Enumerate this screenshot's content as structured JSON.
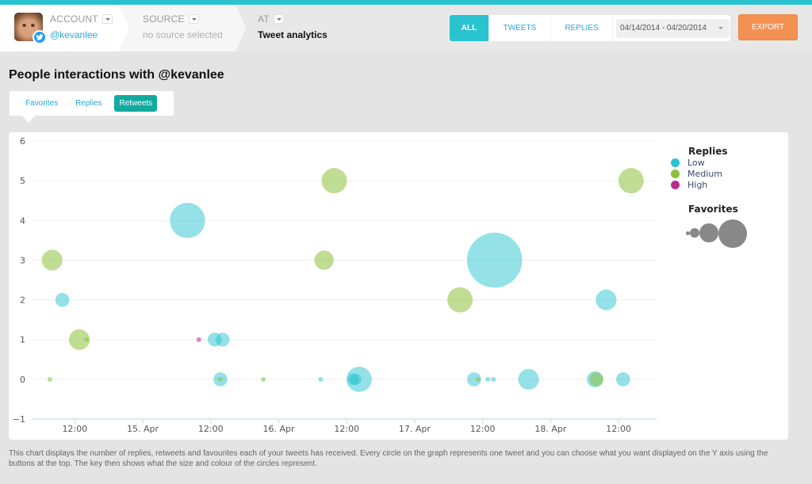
{
  "header": {
    "account": {
      "label": "ACCOUNT",
      "value": "@kevanlee"
    },
    "source": {
      "label": "SOURCE",
      "value": "no source selected"
    },
    "at": {
      "label": "AT",
      "value": "Tweet analytics"
    },
    "filters": [
      {
        "label": "ALL",
        "active": true
      },
      {
        "label": "TWEETS",
        "active": false
      },
      {
        "label": "REPLIES",
        "active": false
      }
    ],
    "date_range": "04/14/2014 - 04/20/2014",
    "export_label": "EXPORT"
  },
  "section_title": "People interactions with @kevanlee",
  "y_tabs": [
    {
      "label": "Favorites",
      "active": false
    },
    {
      "label": "Replies",
      "active": false
    },
    {
      "label": "Retweets",
      "active": true
    }
  ],
  "legend": {
    "color_title": "Replies",
    "color_items": [
      {
        "label": "Low",
        "color": "#2ac4d2"
      },
      {
        "label": "Medium",
        "color": "#8cc13c"
      },
      {
        "label": "High",
        "color": "#bb2c8e"
      }
    ],
    "size_title": "Favorites"
  },
  "footnote": "This chart displays the number of replies, retweets and favourites each of your tweets has received. Every circle on the graph represents one tweet and you can choose what you want displayed on the Y axis using the buttons at the top. The key then shows what the size and colour of the circles represent.",
  "chart_data": {
    "type": "scatter",
    "title": "People interactions with @kevanlee",
    "xlabel": "",
    "ylabel": "Retweets",
    "x_unit": "hours since 14 Apr 2014 00:00",
    "xlim_hours": [
      4.4,
      114.7
    ],
    "ylim": [
      -1,
      6
    ],
    "yticks": [
      -1,
      0,
      1,
      2,
      3,
      4,
      5,
      6
    ],
    "xticks": [
      {
        "hour": 12,
        "label": "12:00"
      },
      {
        "hour": 24,
        "label": "15. Apr"
      },
      {
        "hour": 36,
        "label": "12:00"
      },
      {
        "hour": 48,
        "label": "16. Apr"
      },
      {
        "hour": 60,
        "label": "12:00"
      },
      {
        "hour": 72,
        "label": "17. Apr"
      },
      {
        "hour": 84,
        "label": "12:00"
      },
      {
        "hour": 96,
        "label": "18. Apr"
      },
      {
        "hour": 108,
        "label": "12:00"
      }
    ],
    "grid": true,
    "size_encodes": "Favorites",
    "color_encodes": "Replies",
    "points": [
      {
        "hour": 7.6,
        "retweets": 0,
        "replies": "Medium",
        "favorites": 0
      },
      {
        "hour": 8.0,
        "retweets": 3,
        "replies": "Medium",
        "favorites": 6
      },
      {
        "hour": 9.8,
        "retweets": 2,
        "replies": "Low",
        "favorites": 2
      },
      {
        "hour": 12.8,
        "retweets": 1,
        "replies": "Medium",
        "favorites": 6
      },
      {
        "hour": 14.1,
        "retweets": 1,
        "replies": "Medium",
        "favorites": 0
      },
      {
        "hour": 31.9,
        "retweets": 4,
        "replies": "Low",
        "favorites": 22
      },
      {
        "hour": 33.9,
        "retweets": 1,
        "replies": "High",
        "favorites": 0
      },
      {
        "hour": 36.7,
        "retweets": 1,
        "replies": "Low",
        "favorites": 2
      },
      {
        "hour": 38.1,
        "retweets": 1,
        "replies": "Low",
        "favorites": 2
      },
      {
        "hour": 37.7,
        "retweets": 0,
        "replies": "Low",
        "favorites": 2
      },
      {
        "hour": 37.7,
        "retweets": 0,
        "replies": "Medium",
        "favorites": 0
      },
      {
        "hour": 45.3,
        "retweets": 0,
        "replies": "Medium",
        "favorites": 0
      },
      {
        "hour": 56.0,
        "retweets": 3,
        "replies": "Medium",
        "favorites": 5
      },
      {
        "hour": 57.8,
        "retweets": 5,
        "replies": "Medium",
        "favorites": 10
      },
      {
        "hour": 55.4,
        "retweets": 0,
        "replies": "Low",
        "favorites": 0
      },
      {
        "hour": 61.1,
        "retweets": 0,
        "replies": "Low",
        "favorites": 1
      },
      {
        "hour": 61.6,
        "retweets": 0,
        "replies": "Low",
        "favorites": 1
      },
      {
        "hour": 62.2,
        "retweets": 0,
        "replies": "Low",
        "favorites": 10
      },
      {
        "hour": 80.0,
        "retweets": 2,
        "replies": "Medium",
        "favorites": 10
      },
      {
        "hour": 86.1,
        "retweets": 3,
        "replies": "Low",
        "favorites": 60
      },
      {
        "hour": 82.5,
        "retweets": 0,
        "replies": "Low",
        "favorites": 2
      },
      {
        "hour": 83.2,
        "retweets": 0,
        "replies": "Medium",
        "favorites": 0
      },
      {
        "hour": 84.9,
        "retweets": 0,
        "replies": "Low",
        "favorites": 0
      },
      {
        "hour": 85.9,
        "retweets": 0,
        "replies": "Low",
        "favorites": 0
      },
      {
        "hour": 92.1,
        "retweets": 0,
        "replies": "Low",
        "favorites": 6
      },
      {
        "hour": 103.8,
        "retweets": 0,
        "replies": "Low",
        "favorites": 3
      },
      {
        "hour": 104.1,
        "retweets": 0,
        "replies": "Medium",
        "favorites": 2
      },
      {
        "hour": 105.8,
        "retweets": 2,
        "replies": "Low",
        "favorites": 6
      },
      {
        "hour": 108.8,
        "retweets": 0,
        "replies": "Low",
        "favorites": 2
      },
      {
        "hour": 110.2,
        "retweets": 5,
        "replies": "Medium",
        "favorites": 10
      }
    ]
  }
}
